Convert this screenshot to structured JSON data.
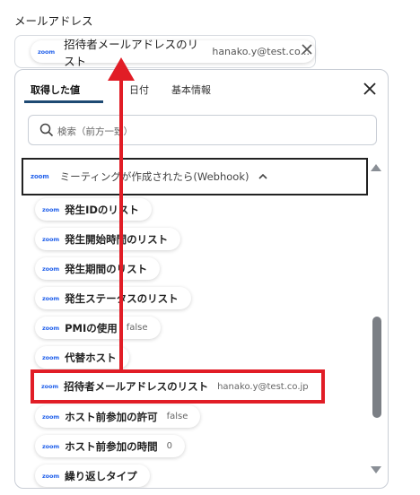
{
  "field": {
    "label": "メールアドレス",
    "selected": {
      "icon": "zoom-logo",
      "logo_text": "zoom",
      "label": "招待者メールアドレスのリスト",
      "value": "hanako.y@test.co..."
    }
  },
  "popup": {
    "tabs": [
      {
        "label": "取得した値",
        "active": true
      },
      {
        "label": "日付",
        "active": false
      },
      {
        "label": "基本情報",
        "active": false
      }
    ],
    "search": {
      "placeholder": "検索（前方一致）"
    },
    "group": {
      "logo_text": "zoom",
      "title": "ミーティングが作成されたら(Webhook)",
      "expanded": true
    },
    "items": [
      {
        "logo_text": "zoom",
        "label": "発生IDのリスト",
        "value": ""
      },
      {
        "logo_text": "zoom",
        "label": "発生開始時間のリスト",
        "value": ""
      },
      {
        "logo_text": "zoom",
        "label": "発生期間のリスト",
        "value": ""
      },
      {
        "logo_text": "zoom",
        "label": "発生ステータスのリスト",
        "value": ""
      },
      {
        "logo_text": "zoom",
        "label": "PMIの使用",
        "value": "false"
      },
      {
        "logo_text": "zoom",
        "label": "代替ホスト",
        "value": ""
      },
      {
        "logo_text": "zoom",
        "label": "招待者メールアドレスのリスト",
        "value": "hanako.y@test.co.jp",
        "highlighted": true
      },
      {
        "logo_text": "zoom",
        "label": "ホスト前参加の許可",
        "value": "false"
      },
      {
        "logo_text": "zoom",
        "label": "ホスト前参加の時間",
        "value": "0"
      },
      {
        "logo_text": "zoom",
        "label": "繰り返しタイプ",
        "value": ""
      }
    ]
  },
  "colors": {
    "zoom_brand": "#2563eb",
    "highlight_outline": "#e11d26",
    "annotation_arrow": "#e11d26",
    "active_tab_underline": "#1e4a73"
  }
}
